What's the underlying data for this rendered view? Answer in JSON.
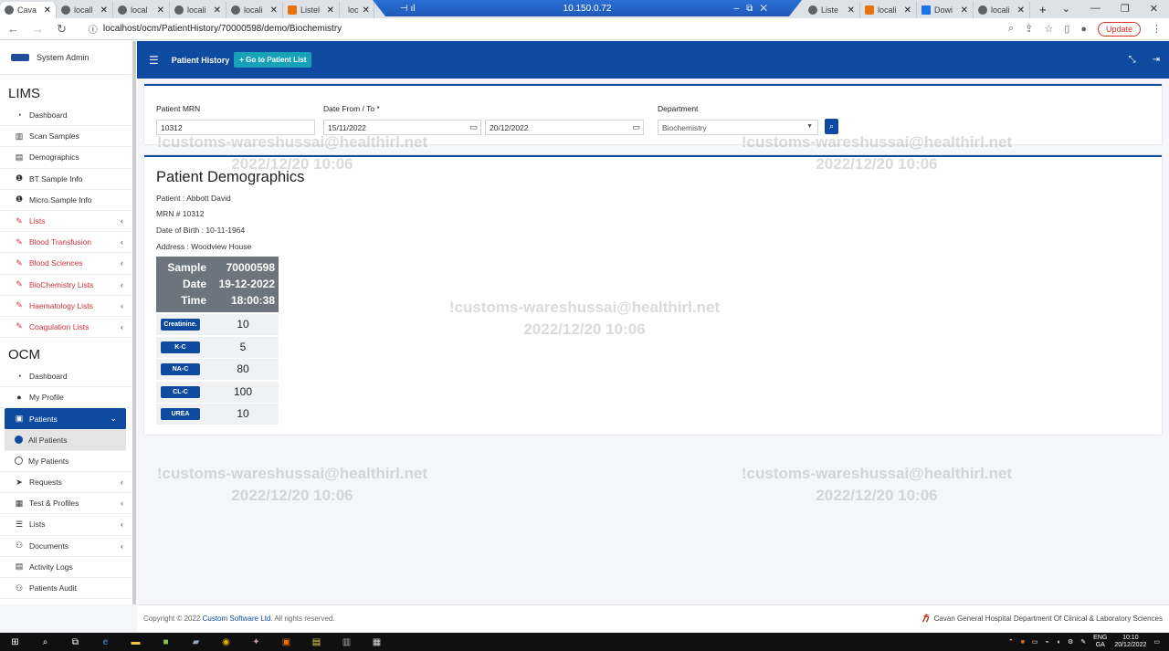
{
  "browser": {
    "tabs": [
      {
        "label": "Cava",
        "active": true
      },
      {
        "label": "locall"
      },
      {
        "label": "local"
      },
      {
        "label": "locali"
      },
      {
        "label": "locali"
      },
      {
        "label": "Listel"
      },
      {
        "label": "loc"
      },
      {
        "label": "Liste"
      },
      {
        "label": "locali"
      },
      {
        "label": "Dowi"
      },
      {
        "label": "locali"
      }
    ],
    "rdp_ip": "10.150.0.72",
    "url": "localhost/ocm/PatientHistory/70000598/demo/Biochemistry",
    "update_label": "Update"
  },
  "sidebar": {
    "user_name": "System Admin",
    "lims_title": "LIMS",
    "lims_items": [
      {
        "label": "Dashboard",
        "icon": "gauge-icon",
        "red": false,
        "chevron": false
      },
      {
        "label": "Scan Samples",
        "icon": "barcode-icon",
        "red": false,
        "chevron": false
      },
      {
        "label": "Demographics",
        "icon": "file-icon",
        "red": false,
        "chevron": false
      },
      {
        "label": "BT Sample Info",
        "icon": "info-icon",
        "red": false,
        "chevron": false
      },
      {
        "label": "Micro.Sample Info",
        "icon": "info-icon",
        "red": false,
        "chevron": false
      },
      {
        "label": "Lists",
        "icon": "pencil-icon",
        "red": true,
        "chevron": true
      },
      {
        "label": "Blood Transfusion",
        "icon": "pencil-icon",
        "red": true,
        "chevron": true
      },
      {
        "label": "Blood Sciences",
        "icon": "pencil-icon",
        "red": true,
        "chevron": true
      },
      {
        "label": "BioChemistry Lists",
        "icon": "pencil-icon",
        "red": true,
        "chevron": true
      },
      {
        "label": "Haematology Lists",
        "icon": "pencil-icon",
        "red": true,
        "chevron": true
      },
      {
        "label": "Coagulation Lists",
        "icon": "pencil-icon",
        "red": true,
        "chevron": true
      }
    ],
    "ocm_title": "OCM",
    "ocm_items": [
      {
        "label": "Dashboard",
        "icon": "gauge-icon"
      },
      {
        "label": "My Profile",
        "icon": "user-icon"
      },
      {
        "label": "Patients",
        "icon": "id-card-icon"
      },
      {
        "label": "All Patients"
      },
      {
        "label": "My Patients"
      },
      {
        "label": "Requests",
        "icon": "send-icon"
      },
      {
        "label": "Test & Profiles",
        "icon": "tests-icon"
      },
      {
        "label": "Lists",
        "icon": "list-icon"
      },
      {
        "label": "Documents",
        "icon": "users-icon"
      },
      {
        "label": "Activity Logs",
        "icon": "log-icon"
      },
      {
        "label": "Patients Audit",
        "icon": "users-icon"
      }
    ]
  },
  "header": {
    "title": "Patient History",
    "goto_label": "+ Go to Patient List"
  },
  "filter": {
    "mrn_label": "Patient MRN",
    "mrn_value": "10312",
    "date_label": "Date From / To *",
    "date_from": "15/11/2022",
    "date_to": "20/12/2022",
    "dept_label": "Department",
    "dept_value": "Biochemistry"
  },
  "demographics": {
    "title": "Patient Demographics",
    "patient": "Patient : Abbott David",
    "mrn": "MRN # 10312",
    "dob": "Date of Birth : 10-11-1964",
    "address": "Address : Woodview House",
    "sample_label": "Sample",
    "sample_value": "70000598",
    "date_label": "Date",
    "date_value": "19-12-2022",
    "time_label": "Time",
    "time_value": "18:00:38",
    "results": [
      {
        "test": "Creatinine.",
        "value": "10"
      },
      {
        "test": "K-C",
        "value": "5"
      },
      {
        "test": "NA-C",
        "value": "80"
      },
      {
        "test": "CL-C",
        "value": "100"
      },
      {
        "test": "UREA",
        "value": "10"
      }
    ]
  },
  "watermark": {
    "line1": "!customs-wareshussai@healthirl.net",
    "line2": "2022/12/20 10:06"
  },
  "footer": {
    "copyright": "Copyright © 2022",
    "company": "Custom Software Ltd.",
    "rights": "All rights reserved.",
    "hospital": "Cavan General Hospital Department Of Clinical & Laboratory Sciences"
  },
  "taskbar": {
    "lang1": "ENG",
    "lang2": "GA",
    "time": "10:10",
    "date": "20/12/2022"
  }
}
